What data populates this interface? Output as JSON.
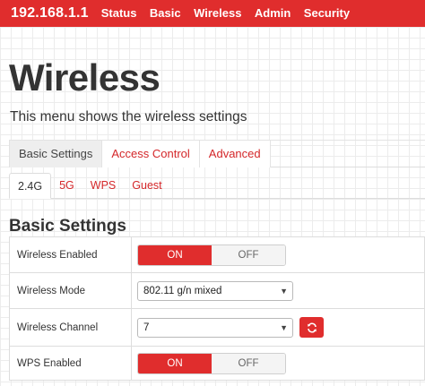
{
  "header": {
    "brand": "192.168.1.1",
    "nav": [
      "Status",
      "Basic",
      "Wireless",
      "Admin",
      "Security"
    ]
  },
  "page": {
    "title": "Wireless",
    "description": "This menu shows the wireless settings"
  },
  "main_tabs": [
    "Basic Settings",
    "Access Control",
    "Advanced"
  ],
  "main_tab_active": "Basic Settings",
  "sub_tabs": [
    "2.4G",
    "5G",
    "WPS",
    "Guest"
  ],
  "sub_tab_active": "2.4G",
  "section": {
    "title": "Basic Settings"
  },
  "settings": {
    "wireless_enabled": {
      "label": "Wireless Enabled",
      "on": "ON",
      "off": "OFF",
      "value": "ON"
    },
    "wireless_mode": {
      "label": "Wireless Mode",
      "value": "802.11 g/n mixed"
    },
    "wireless_channel": {
      "label": "Wireless Channel",
      "value": "7"
    },
    "wps_enabled": {
      "label": "WPS Enabled",
      "on": "ON",
      "off": "OFF",
      "value": "ON"
    }
  },
  "icons": {
    "select": "chevron-down-icon",
    "refresh": "refresh-icon"
  },
  "colors": {
    "accent": "#e02d2d",
    "link": "#d4272a"
  }
}
